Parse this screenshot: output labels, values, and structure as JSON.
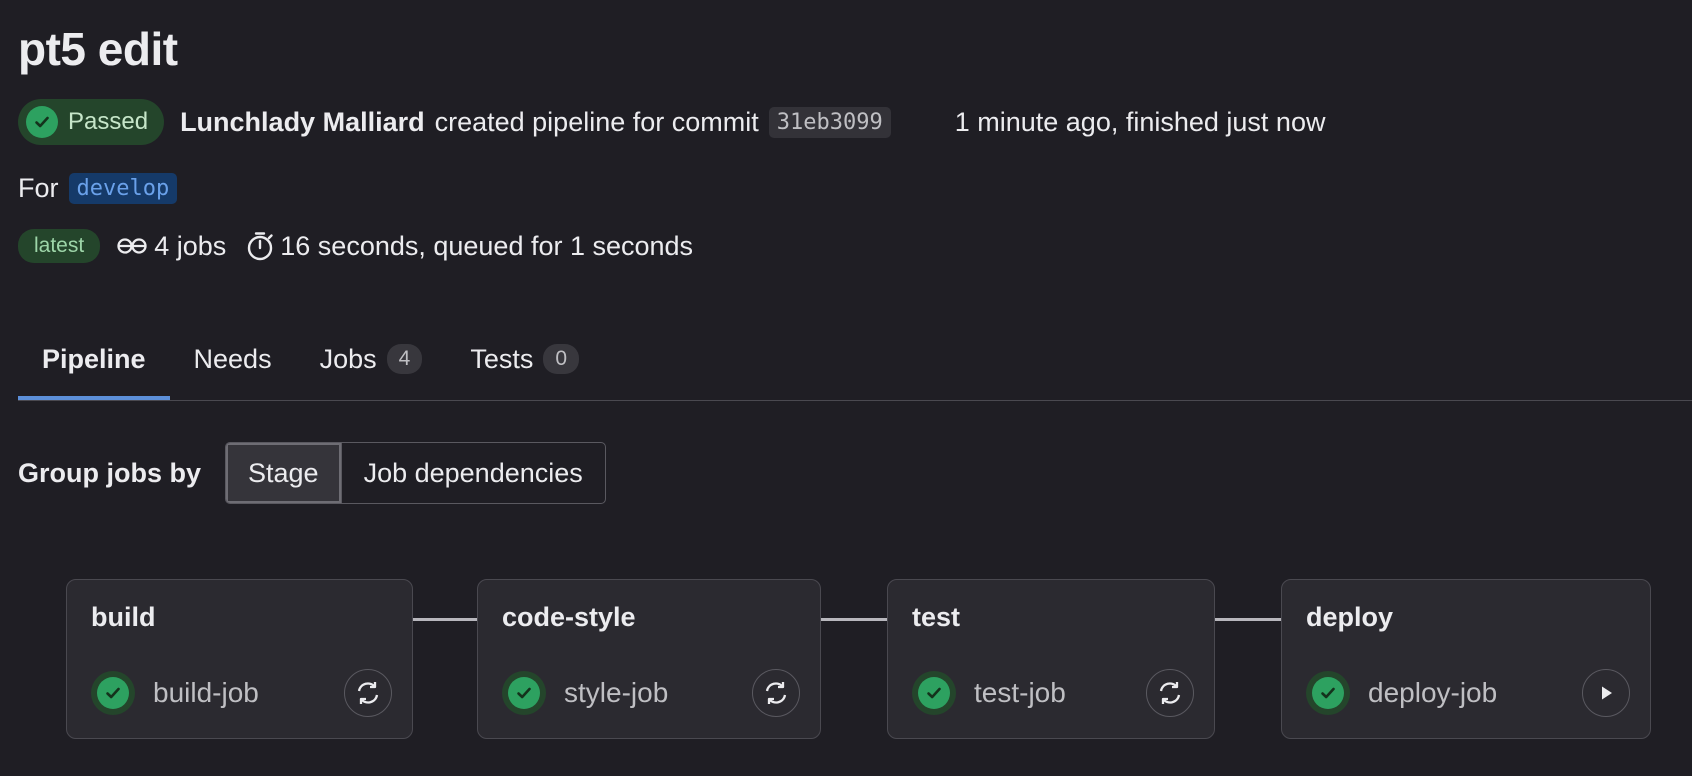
{
  "pipeline": {
    "title": "pt5 edit",
    "status_label": "Passed",
    "author": "Lunchlady Malliard",
    "created_text": "created pipeline for commit",
    "commit_sha": "31eb3099",
    "time_text": "1 minute ago, finished just now",
    "for_label": "For",
    "branch": "develop",
    "latest_badge": "latest",
    "jobs_count": "4 jobs",
    "duration": "16 seconds, queued for 1 seconds"
  },
  "tabs": [
    {
      "label": "Pipeline"
    },
    {
      "label": "Needs"
    },
    {
      "label": "Jobs",
      "count": "4"
    },
    {
      "label": "Tests",
      "count": "0"
    }
  ],
  "group_by": {
    "label": "Group jobs by",
    "options": [
      "Stage",
      "Job dependencies"
    ],
    "selected": "Stage"
  },
  "stages": [
    {
      "name": "build",
      "job": "build-job",
      "action": "retry-icon"
    },
    {
      "name": "code-style",
      "job": "style-job",
      "action": "retry-icon"
    },
    {
      "name": "test",
      "job": "test-job",
      "action": "retry-icon"
    },
    {
      "name": "deploy",
      "job": "deploy-job",
      "action": "play-icon"
    }
  ],
  "colors": {
    "background": "#1f1e24",
    "success": "#2da160",
    "success_bg": "#24452b",
    "tab_active": "#5c8fd9",
    "branch_bg": "#153a69",
    "branch_text": "#6aa1ea"
  }
}
